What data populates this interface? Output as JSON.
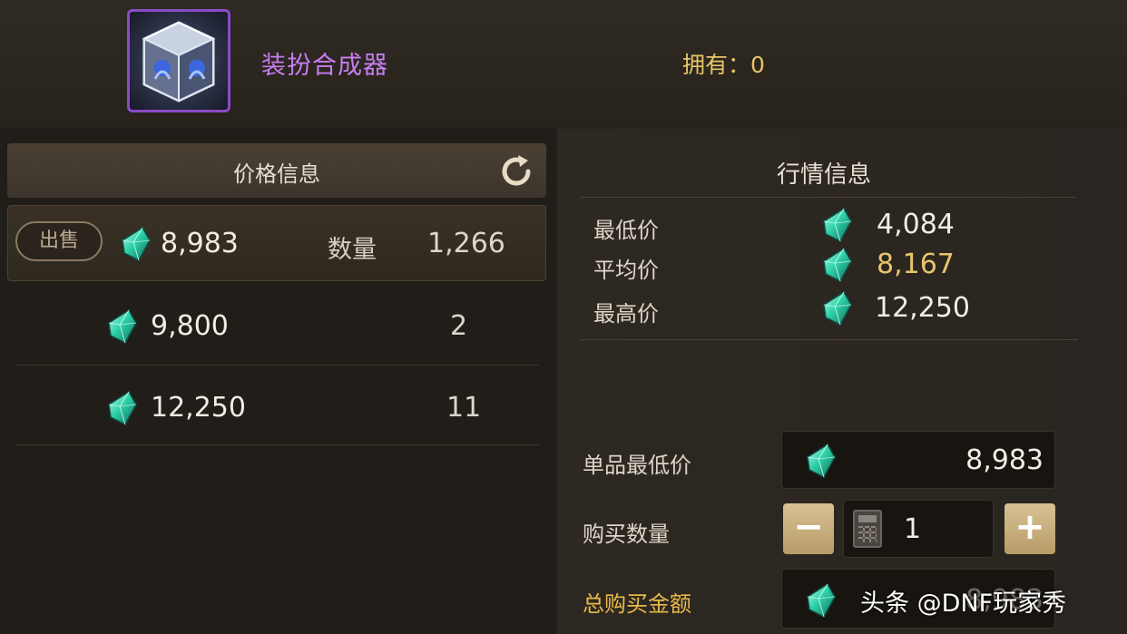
{
  "item": {
    "name": "装扮合成器",
    "owned_label": "拥有：",
    "owned_count": "0",
    "icon": "cube-box-icon"
  },
  "price_panel": {
    "title": "价格信息",
    "refresh_icon": "refresh-icon",
    "selected_row": {
      "sell_label": "出售",
      "price": "8,983",
      "qty_label": "数量",
      "qty": "1,266"
    },
    "rows": [
      {
        "price": "9,800",
        "qty": "2"
      },
      {
        "price": "12,250",
        "qty": "11"
      }
    ]
  },
  "market_panel": {
    "title": "行情信息",
    "stats": [
      {
        "label": "最低价",
        "value": "4,084"
      },
      {
        "label": "平均价",
        "value": "8,167"
      },
      {
        "label": "最高价",
        "value": "12,250"
      }
    ]
  },
  "purchase": {
    "min_price_label": "单品最低价",
    "min_price": "8,983",
    "qty_label": "购买数量",
    "qty_value": "1",
    "minus_label": "−",
    "plus_label": "+",
    "total_label": "总购买金额",
    "total_value": "8,983"
  },
  "watermark": "头条 @DNF玩家秀",
  "colors": {
    "gem": "#2fd1a8",
    "gold": "#e8c46a",
    "purple": "#c77df0"
  }
}
